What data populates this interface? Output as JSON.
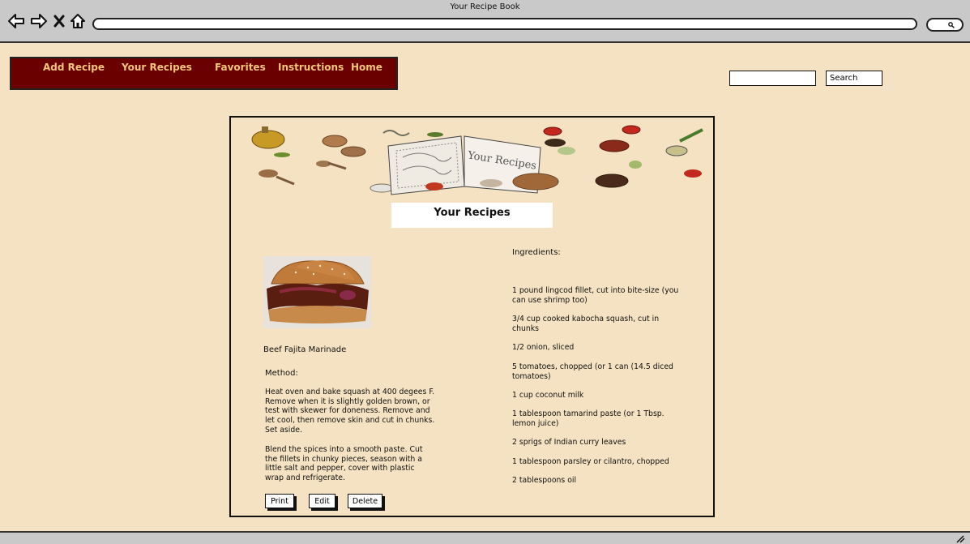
{
  "window": {
    "title": "Your Recipe Book"
  },
  "browser": {
    "icons": [
      "back-arrow-icon",
      "forward-arrow-icon",
      "close-x-icon",
      "home-icon",
      "search-icon"
    ],
    "url": ""
  },
  "menu": {
    "items": [
      {
        "label": "Add Recipe"
      },
      {
        "label": "Your Recipes"
      },
      {
        "label": "Favorites"
      },
      {
        "label": "Instructions"
      },
      {
        "label": "Home"
      }
    ]
  },
  "search": {
    "value": "",
    "button_label": "Search"
  },
  "page": {
    "title": "Your Recipes",
    "banner_text": "Your Recipes"
  },
  "recipe": {
    "name": "Beef Fajita Marinade",
    "method_label": "Method:",
    "method": [
      "Heat oven and bake squash at 400 degees F. Remove when it is slightly golden brown, or test with skewer for doneness. Remove and let cool, then remove skin and cut in chunks. Set aside.",
      "Blend the spices into a smooth paste. Cut the fillets in chunky pieces, season with a little salt and pepper, cover with plastic wrap and refrigerate."
    ],
    "ingredients_label": "Ingredients:",
    "ingredients": [
      "1 pound lingcod fillet, cut into bite-size (you can use shrimp too)",
      "3/4 cup cooked kabocha squash, cut in chunks",
      "1/2 onion, sliced",
      "5 tomatoes, chopped (or 1 can (14.5 diced tomatoes)",
      "1 cup coconut milk",
      "1 tablespoon tamarind paste (or 1 Tbsp. lemon juice)",
      "2 sprigs of Indian curry leaves",
      "1 tablespoon parsley or cilantro, chopped",
      "2 tablespoons oil"
    ]
  },
  "actions": {
    "print": "Print",
    "edit": "Edit",
    "delete": "Delete"
  },
  "colors": {
    "background": "#f4e2c2",
    "menu_bg": "#6b0000",
    "menu_text": "#f3c57a",
    "chrome": "#c9c9c9"
  }
}
